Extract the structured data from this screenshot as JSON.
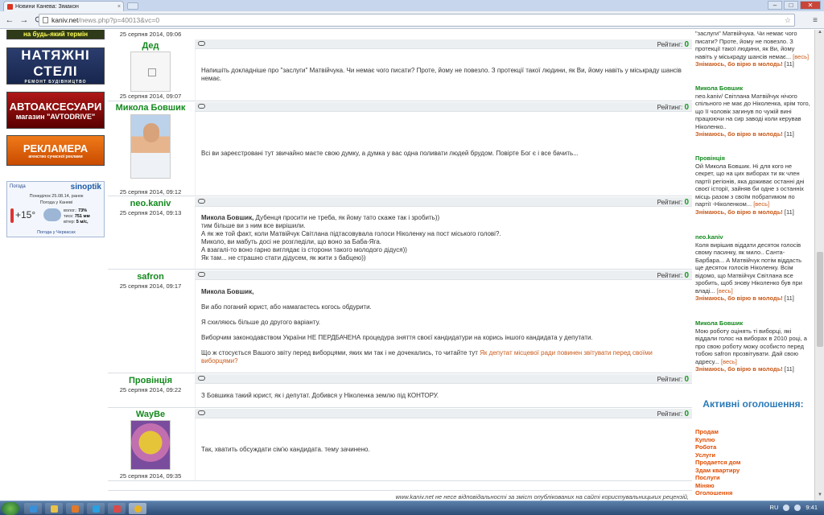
{
  "browser": {
    "tab_title": "Новини Канева: Зімакон",
    "tab_close": "×",
    "url_host": "kaniv.net",
    "url_path": "/news.php?p=40013&vc=0",
    "back": "←",
    "forward": "→",
    "reload": "⟳",
    "star": "☆",
    "menu": "≡",
    "win_min": "–",
    "win_max": "□",
    "win_close": "✕"
  },
  "banners": {
    "b0": "на будь-який термін",
    "b1_title": "НАТЯЖНІ СТЕЛІ",
    "b1_small": "РЕМОНТ БУДІВНИЦТВО",
    "b2_title": "АВТОАКСЕСУАРИ",
    "b2_small": "магазин \"AVTODRIVE\"",
    "b3_title": "РЕКЛАМЕРА",
    "b3_small": "агенство сучасної реклами"
  },
  "weather": {
    "title": "Погода",
    "brand": "sinoptik",
    "date": "Понеділок 25.08.14, ранок",
    "city": "Погода у Каневі",
    "temp": "+15°",
    "humidity_label": "волог.:",
    "humidity": "73%",
    "pressure_label": "тиск:",
    "pressure": "751 мм",
    "wind_label": "вітер:",
    "wind": "5 м/с,",
    "footer": "Погода у Черкасах"
  },
  "rating_label": "Рейтинг:",
  "comments": [
    {
      "author": "Дед",
      "date": "25 серпня 2014, 09:07",
      "rating": "0",
      "paragraphs": [
        "Напишіть докладніше про \"заслуги\" Матвійчука. Чи немає чого писати? Проте, йому не повезло. З протекції такої людини, як Ви, йому навіть у міськраду шансів немає."
      ]
    },
    {
      "author": "Микола Бовшик",
      "date": "25 серпня 2014, 09:12",
      "rating": "0",
      "paragraphs": [
        "Всі ви зареєстровані тут звичайно маєте свою думку, а думка у вас одна поливати людей брудом. Повірте Бог є і все бачить..."
      ]
    },
    {
      "author": "neo.kaniv",
      "date": "25 серпня 2014, 09:13",
      "rating": "0",
      "addressee": "Микола Бовшик,",
      "first_line_rest": " Дубенця просити не треба, як йому тато скаже так і зробить))",
      "lines": [
        "тим більше ви з ним все вирішили.",
        "А як же той факт, коли Матвійчук Світлана підтасовувала голоси Ніколенку на пост міського голові?.",
        "Миколо, ви мабуть досі не розгледіли, що воно за Баба-Яга.",
        "А взагалі-то воно гарно виглядає із сторони такого молодого дідуся))",
        "Як там... не страшно стати дідусем, як жити з бабцею))"
      ]
    },
    {
      "author": "safron",
      "date": "25 серпня 2014, 09:17",
      "rating": "0",
      "addressee": "Микола Бовшик,",
      "paragraphs": [
        "Ви або поганий юрист, або намагаєтесь когось обдурити.",
        "Я схиляюсь більше до другого варіанту.",
        "Виборчим законодавством України НЕ ПЕРДБАЧЕНА процедура зняття своєї кандидатури на корись іншого кандидата у депутати."
      ],
      "last_text": "Що ж стосується Вашого звіту перед виборцями, яких ми так і не дочекались, то читайте тут ",
      "last_link": "Як депутат місцевої ради повинен звітувати перед своїми виборцями?"
    },
    {
      "author": "Провінція",
      "date": "25 серпня 2014, 09:22",
      "rating": "0",
      "paragraphs": [
        "З Бовшика такий юрист, як і депутат. Добився у Ніколенка землю під КОНТОРУ."
      ]
    },
    {
      "author": "WayBe",
      "date": "25 серпня 2014, 09:35",
      "rating": "0",
      "paragraphs": [
        "Так, хватить обсуждати сім'ю кандидата. тему зачинено."
      ]
    }
  ],
  "top_date": "25 серпня 2014, 09:06",
  "footer_note": "www.kaniv.net не несе відповідальності за зміст опублікованих на сайті користувальницьких рецензій,",
  "sidebar": {
    "more_label": "[весь]",
    "sub_label": "Знімаюсь, бо вірю в молодь!",
    "items": [
      {
        "author": "",
        "text": "\"заслуги\" Матвійчука. Чи немає чого писати? Проте, йому не повезло. З протекції такої людини, як Ви, йому навіть у міськраду шансів немає...",
        "count": "[11]"
      },
      {
        "author": "Микола Бовшик",
        "text": "neo.kaniv/ Світлана Матвійчук нічого спільного не має до Ніколенка, крім того, що її чоловік загинув по чужій вині працюючи на сир заводі коли керував Ніколенко..",
        "count": "[11]"
      },
      {
        "author": "Провінція",
        "text": "Ой Микола Бовшик. Ні для кого не секрет, що на цих виборах ти як член партії регіонів, яка доживає останні дні своєї історії, зайняв би одне з останніх місць разом з своїм побратимом по партії -Ніколенком...",
        "count": "[11]"
      },
      {
        "author": "neo.kaniv",
        "text": "Коля вирішив віддати десяток голосів свому пасинку, як мило.. Санта-Барбара... А Матвійчук потім віддасть ще десяток голосів Ніколенку. Всім відомо, що Матвійчук Світлана все зробить, щоб знову Ніколенко був при владі...",
        "count": "[11]"
      },
      {
        "author": "Микола Бовшик",
        "text": "Мою роботу оцінять ті виборці, які віддали голос на виборах в 2010 році, а про свою роботу можу особисто перед тобою safron прозвітувати. Дай свою адресу...",
        "count": "[11]"
      }
    ],
    "ads_title": "Активні оголошення:",
    "ads": [
      "Продам",
      "Куплю",
      "Робота",
      "Услуги",
      "Продается дом",
      "Здам квартиру",
      "Послуги",
      "Міняю",
      "Оголошення"
    ]
  },
  "taskbar": {
    "lang": "RU",
    "time": "9:41"
  }
}
